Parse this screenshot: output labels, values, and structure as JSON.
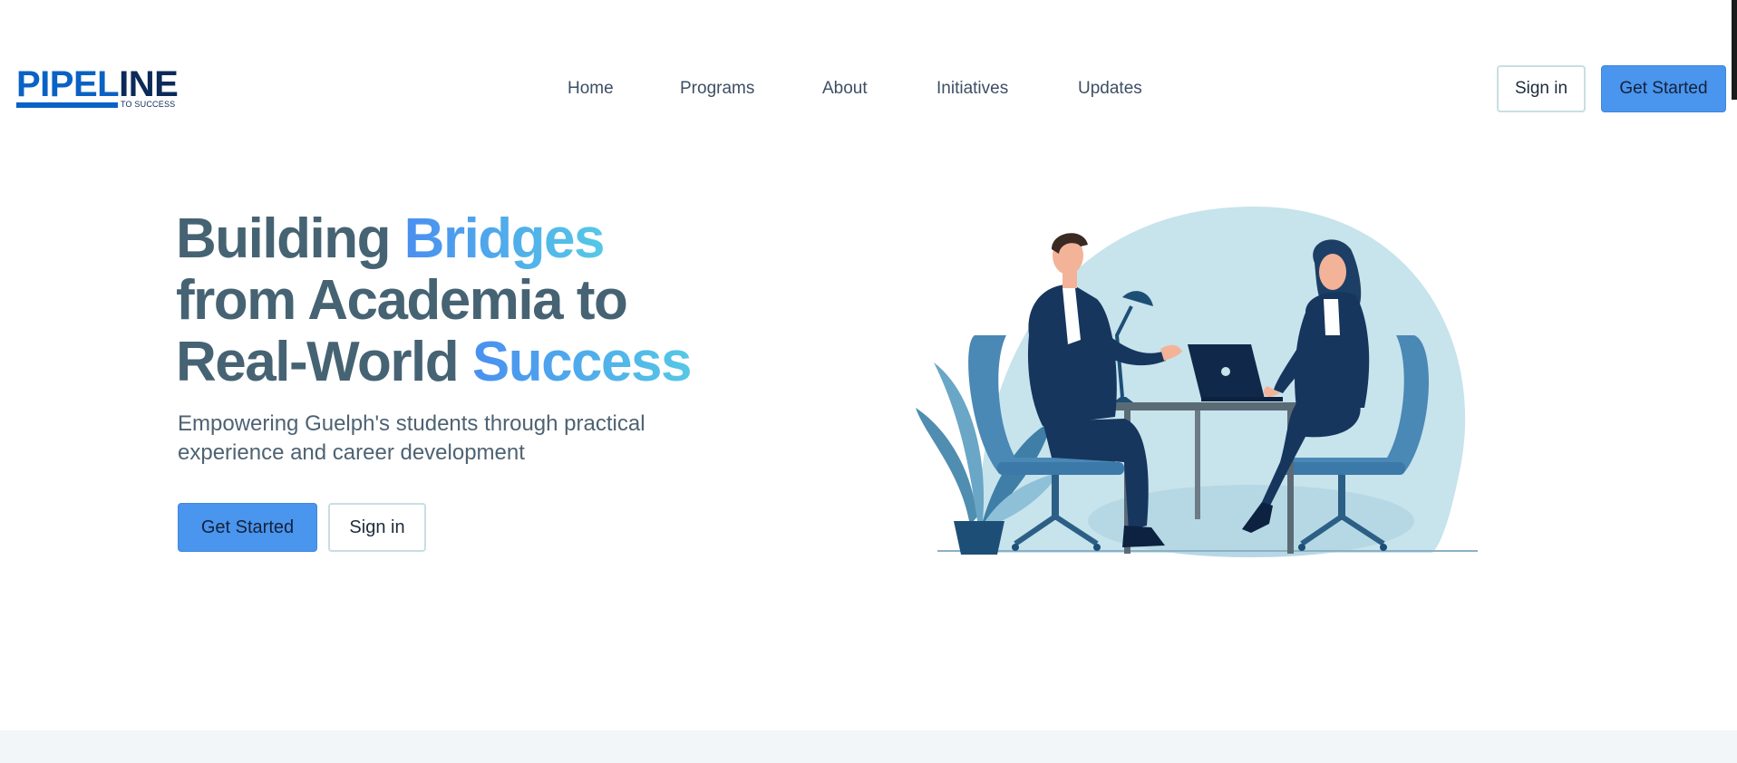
{
  "logo": {
    "word_blue": "PIPEL",
    "word_dark": "INE",
    "tagline": "TO SUCCESS"
  },
  "nav": {
    "items": [
      {
        "label": "Home"
      },
      {
        "label": "Programs"
      },
      {
        "label": "About"
      },
      {
        "label": "Initiatives"
      },
      {
        "label": "Updates"
      }
    ]
  },
  "header_actions": {
    "sign_in": "Sign in",
    "get_started": "Get Started"
  },
  "hero": {
    "title_part1": "Building ",
    "title_accent1": "Bridges",
    "title_part2": "from Academia to",
    "title_part3": "Real-World ",
    "title_accent2": "Success",
    "subtitle": "Empowering Guelph's students through practical experience and career development",
    "primary_cta": "Get Started",
    "secondary_cta": "Sign in"
  },
  "colors": {
    "primary": "#4a95ee",
    "heading": "#466373",
    "accent_gradient_start": "#4a8ff0",
    "accent_gradient_end": "#55c8e6",
    "logo_blue": "#0a62c4",
    "logo_dark": "#0b2a5a"
  },
  "illustration": {
    "subject": "two-professionals-meeting-at-desk-illustration"
  }
}
